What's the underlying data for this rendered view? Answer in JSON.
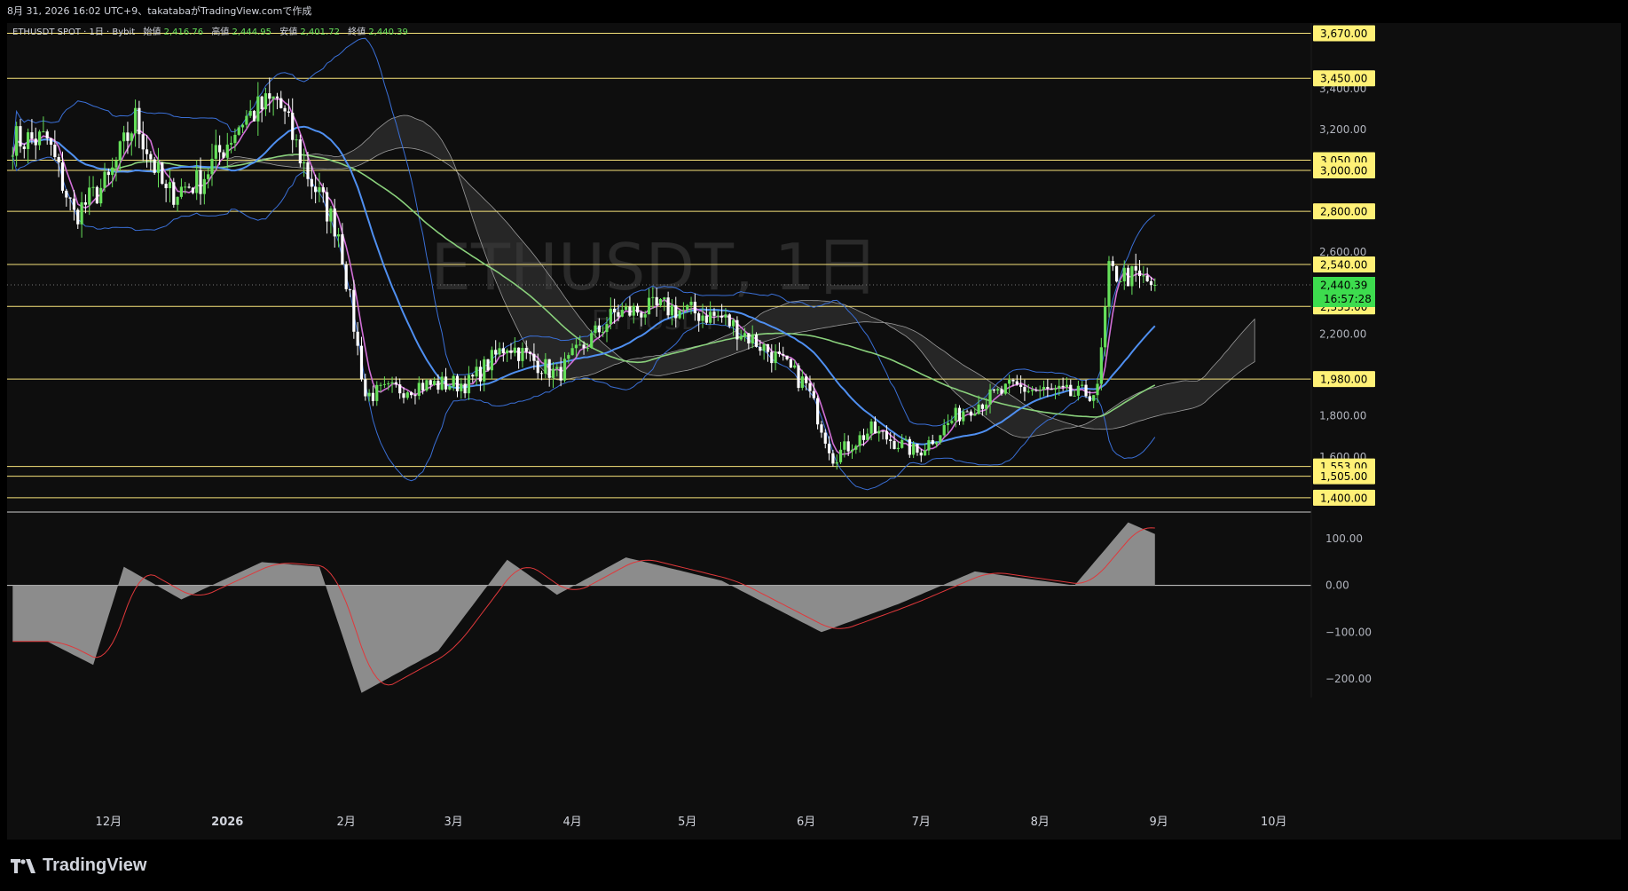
{
  "header": {
    "caption": "8月 31, 2026 16:02 UTC+9、takatabaがTradingView.comで作成"
  },
  "legend": {
    "symbol": "ETHUSDT SPOT · 1日 · Bybit",
    "open_label": "始値",
    "open": "2,416.76",
    "high_label": "高値",
    "high": "2,444.95",
    "low_label": "安値",
    "low": "2,401.72",
    "close_label": "終値",
    "close": "2,440.39"
  },
  "watermark": {
    "title": "ETHUSDT, 1日",
    "subtitle": "ETHUSDT"
  },
  "price_axis": {
    "ticks": [
      "3,400.00",
      "3,200.00",
      "2,600.00",
      "2,200.00",
      "1,800.00",
      "1,600.00"
    ],
    "levels": [
      "3,670.00",
      "3,450.00",
      "3,050.00",
      "3,000.00",
      "2,800.00",
      "2,540.00",
      "2,335.00",
      "1,980.00",
      "1,553.00",
      "1,505.00",
      "1,400.00"
    ],
    "current_price": "2,440.39",
    "countdown": "16:57:28"
  },
  "oscillator_axis": {
    "ticks": [
      "100.00",
      "0.00",
      "−100.00",
      "−200.00"
    ]
  },
  "time_axis": {
    "labels": [
      "12月",
      "2026",
      "2月",
      "3月",
      "4月",
      "5月",
      "6月",
      "7月",
      "8月",
      "9月",
      "10月"
    ]
  },
  "footer": {
    "brand": "TradingView"
  },
  "colors": {
    "up": "#66e05a",
    "down": "#ffffff",
    "level_line": "#f6e27a",
    "level_badge": "#fff176",
    "ma_fast": "#d06fd6",
    "ma_mid": "#4f8ff0",
    "ma_slow": "#8ad17c",
    "bollinger": "#3a6fd6",
    "cloud": "#9a9a9a",
    "histogram": "#8c8c8c",
    "signal": "#e0383b",
    "price_badge": "#3ddc4e"
  },
  "chart_data": {
    "type": "candlestick",
    "symbol": "ETHUSDT",
    "timeframe": "1日",
    "ylim": [
      1330,
      3720
    ],
    "horizontal_levels": [
      3670,
      3450,
      3050,
      3000,
      2800,
      2540,
      2335,
      1980,
      1553,
      1505,
      1400
    ],
    "approx_close_path": [
      {
        "x": "2025-11-15",
        "y": 3150
      },
      {
        "x": "2025-11-22",
        "y": 2780
      },
      {
        "x": "2025-12-01",
        "y": 2950
      },
      {
        "x": "2025-12-08",
        "y": 3250
      },
      {
        "x": "2025-12-16",
        "y": 2880
      },
      {
        "x": "2025-12-25",
        "y": 2950
      },
      {
        "x": "2026-01-05",
        "y": 3250
      },
      {
        "x": "2026-01-14",
        "y": 3350
      },
      {
        "x": "2026-01-22",
        "y": 2980
      },
      {
        "x": "2026-01-30",
        "y": 2700
      },
      {
        "x": "2026-02-06",
        "y": 1900
      },
      {
        "x": "2026-02-20",
        "y": 1950
      },
      {
        "x": "2026-03-05",
        "y": 1960
      },
      {
        "x": "2026-03-15",
        "y": 2150
      },
      {
        "x": "2026-03-28",
        "y": 2000
      },
      {
        "x": "2026-04-12",
        "y": 2300
      },
      {
        "x": "2026-04-25",
        "y": 2330
      },
      {
        "x": "2026-05-10",
        "y": 2280
      },
      {
        "x": "2026-05-22",
        "y": 2120
      },
      {
        "x": "2026-06-01",
        "y": 1950
      },
      {
        "x": "2026-06-08",
        "y": 1600
      },
      {
        "x": "2026-06-18",
        "y": 1730
      },
      {
        "x": "2026-06-30",
        "y": 1620
      },
      {
        "x": "2026-07-12",
        "y": 1830
      },
      {
        "x": "2026-07-25",
        "y": 1940
      },
      {
        "x": "2026-08-10",
        "y": 1900
      },
      {
        "x": "2026-08-16",
        "y": 1920
      },
      {
        "x": "2026-08-19",
        "y": 2500
      },
      {
        "x": "2026-08-25",
        "y": 2480
      },
      {
        "x": "2026-08-31",
        "y": 2440.39
      }
    ],
    "last_candle": {
      "open": 2416.76,
      "high": 2444.95,
      "low": 2401.72,
      "close": 2440.39
    },
    "oscillator": {
      "ylim": [
        -240,
        140
      ],
      "approx_values": [
        {
          "x": "2025-11-15",
          "y": -120
        },
        {
          "x": "2025-11-27",
          "y": -170
        },
        {
          "x": "2025-12-05",
          "y": 40
        },
        {
          "x": "2025-12-20",
          "y": -30
        },
        {
          "x": "2026-01-10",
          "y": 50
        },
        {
          "x": "2026-01-25",
          "y": 40
        },
        {
          "x": "2026-02-05",
          "y": -230
        },
        {
          "x": "2026-02-25",
          "y": -140
        },
        {
          "x": "2026-03-15",
          "y": 55
        },
        {
          "x": "2026-03-28",
          "y": -20
        },
        {
          "x": "2026-04-15",
          "y": 60
        },
        {
          "x": "2026-05-10",
          "y": 10
        },
        {
          "x": "2026-06-05",
          "y": -100
        },
        {
          "x": "2026-06-25",
          "y": -40
        },
        {
          "x": "2026-07-15",
          "y": 30
        },
        {
          "x": "2026-08-10",
          "y": 0
        },
        {
          "x": "2026-08-24",
          "y": 135
        },
        {
          "x": "2026-08-31",
          "y": 110
        }
      ]
    }
  }
}
